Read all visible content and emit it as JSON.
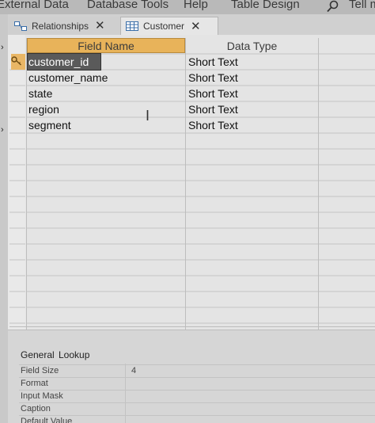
{
  "ribbon": {
    "items": [
      "External Data",
      "Database Tools",
      "Help",
      "Table Design",
      "Tell m"
    ]
  },
  "tabs": [
    {
      "label": "Relationships",
      "active": false
    },
    {
      "label": "Customer",
      "active": true
    }
  ],
  "grid": {
    "headers": {
      "field_name": "Field Name",
      "data_type": "Data Type"
    },
    "rows": [
      {
        "field_name": "customer_id",
        "data_type": "Short Text"
      },
      {
        "field_name": "customer_name",
        "data_type": "Short Text"
      },
      {
        "field_name": "state",
        "data_type": "Short Text"
      },
      {
        "field_name": "region",
        "data_type": "Short Text"
      },
      {
        "field_name": "segment",
        "data_type": "Short Text"
      }
    ]
  },
  "properties": {
    "tabs": [
      "General",
      "Lookup"
    ],
    "rows": [
      {
        "label": "Field Size",
        "value": "4"
      },
      {
        "label": "Format",
        "value": ""
      },
      {
        "label": "Input Mask",
        "value": ""
      },
      {
        "label": "Caption",
        "value": ""
      },
      {
        "label": "Default Value",
        "value": ""
      }
    ]
  },
  "colors": {
    "accent_header": "#e8b35a",
    "selection": "#5a5a5a"
  }
}
